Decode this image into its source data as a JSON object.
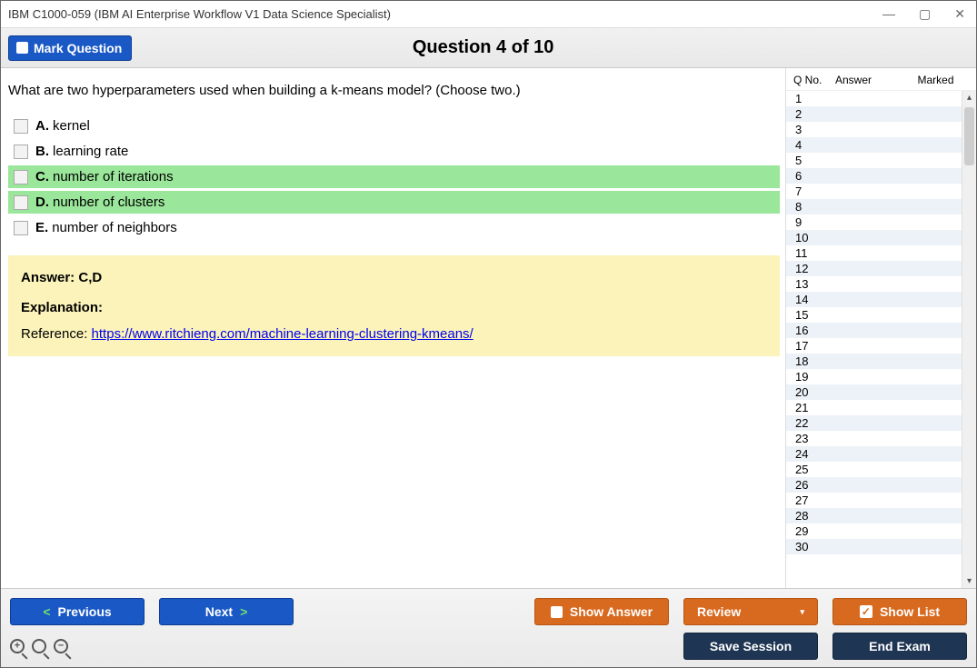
{
  "window": {
    "title": "IBM C1000-059 (IBM AI Enterprise Workflow V1 Data Science Specialist)"
  },
  "header": {
    "mark_button_label": "Mark Question",
    "question_title": "Question 4 of 10"
  },
  "question": {
    "prompt": "What are two hyperparameters used when building a k-means model? (Choose two.)",
    "answers": [
      {
        "letter": "A.",
        "text": "kernel",
        "correct": false
      },
      {
        "letter": "B.",
        "text": "learning rate",
        "correct": false
      },
      {
        "letter": "C.",
        "text": "number of iterations",
        "correct": true
      },
      {
        "letter": "D.",
        "text": "number of clusters",
        "correct": true
      },
      {
        "letter": "E.",
        "text": "number of neighbors",
        "correct": false
      }
    ],
    "answer_line_label": "Answer:",
    "answer_line_value": "C,D",
    "explanation_label": "Explanation:",
    "reference_label": "Reference:",
    "reference_url_text": "https://www.ritchieng.com/machine-learning-clustering-kmeans/"
  },
  "sidepanel": {
    "col_q": "Q No.",
    "col_answer": "Answer",
    "col_marked": "Marked",
    "question_count": 30
  },
  "footer": {
    "previous": "Previous",
    "next": "Next",
    "show_answer": "Show Answer",
    "review": "Review",
    "show_list": "Show List",
    "save_session": "Save Session",
    "end_exam": "End Exam"
  }
}
